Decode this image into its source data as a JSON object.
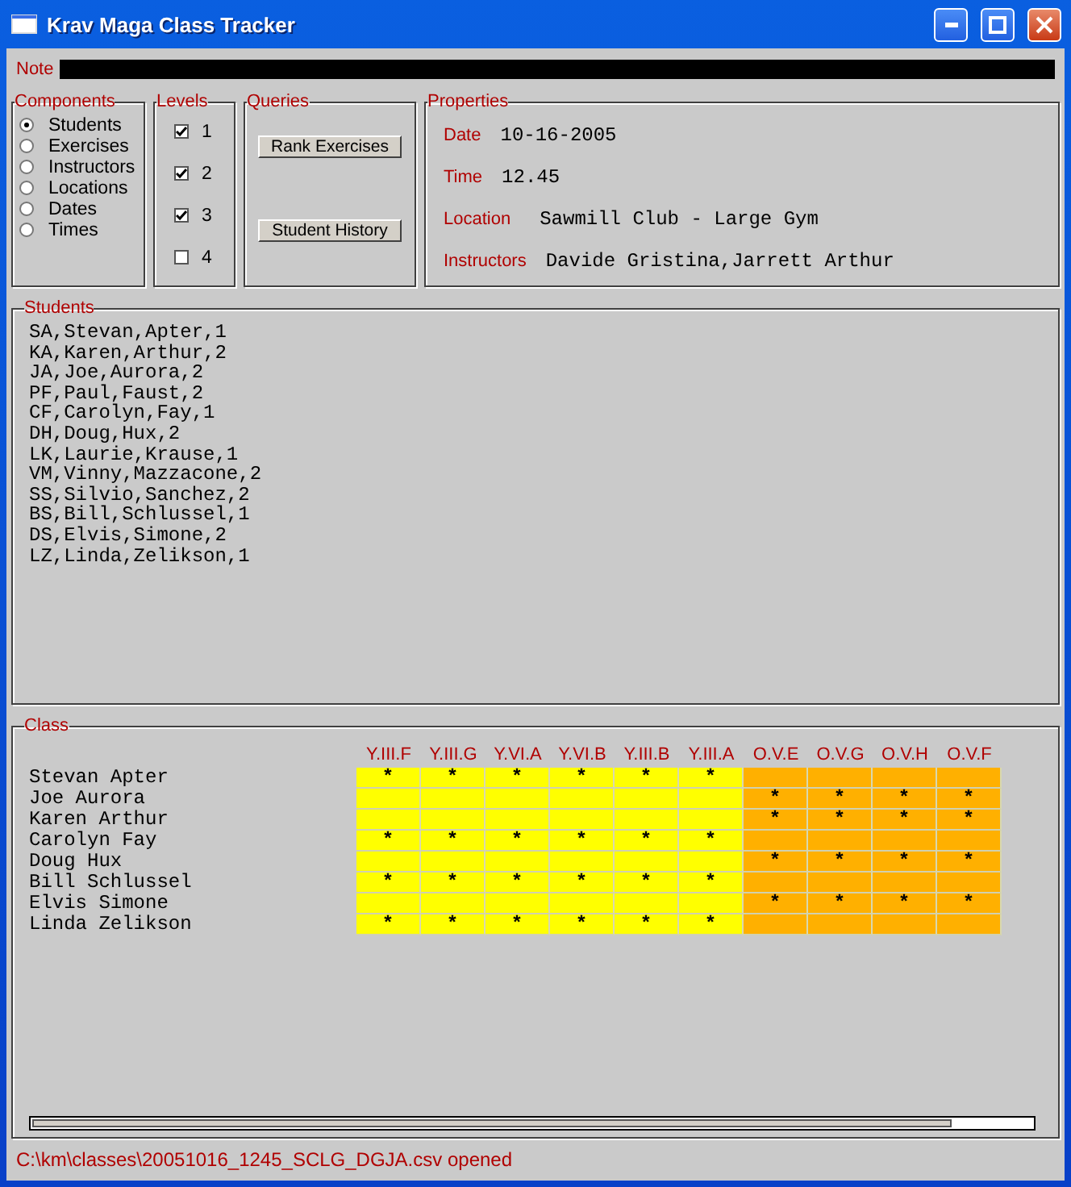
{
  "window": {
    "title": "Krav Maga Class Tracker"
  },
  "note": {
    "label": "Note"
  },
  "components": {
    "title": "Components",
    "options": [
      {
        "label": "Students",
        "selected": true
      },
      {
        "label": "Exercises",
        "selected": false
      },
      {
        "label": "Instructors",
        "selected": false
      },
      {
        "label": "Locations",
        "selected": false
      },
      {
        "label": "Dates",
        "selected": false
      },
      {
        "label": "Times",
        "selected": false
      }
    ]
  },
  "levels": {
    "title": "Levels",
    "items": [
      {
        "label": "1",
        "checked": true
      },
      {
        "label": "2",
        "checked": true
      },
      {
        "label": "3",
        "checked": true
      },
      {
        "label": "4",
        "checked": false
      }
    ]
  },
  "queries": {
    "title": "Queries",
    "buttons": [
      "Rank Exercises",
      "Student History"
    ]
  },
  "properties": {
    "title": "Properties",
    "fields": [
      {
        "label": "Date",
        "value": "10-16-2005"
      },
      {
        "label": "Time",
        "value": "12.45"
      },
      {
        "label": "Location",
        "value": "Sawmill Club - Large Gym"
      },
      {
        "label": "Instructors",
        "value": "Davide Gristina,Jarrett Arthur"
      }
    ]
  },
  "students": {
    "title": "Students",
    "lines": [
      "SA,Stevan,Apter,1",
      "KA,Karen,Arthur,2",
      "JA,Joe,Aurora,2",
      "PF,Paul,Faust,2",
      "CF,Carolyn,Fay,1",
      "DH,Doug,Hux,2",
      "LK,Laurie,Krause,1",
      "VM,Vinny,Mazzacone,2",
      "SS,Silvio,Sanchez,2",
      "BS,Bill,Schlussel,1",
      "DS,Elvis,Simone,2",
      "LZ,Linda,Zelikson,1"
    ]
  },
  "class": {
    "title": "Class",
    "columns": [
      {
        "label": "Y.III.F",
        "color": "#ffff00"
      },
      {
        "label": "Y.III.G",
        "color": "#ffff00"
      },
      {
        "label": "Y.VI.A",
        "color": "#ffff00"
      },
      {
        "label": "Y.VI.B",
        "color": "#ffff00"
      },
      {
        "label": "Y.III.B",
        "color": "#ffff00"
      },
      {
        "label": "Y.III.A",
        "color": "#ffff00"
      },
      {
        "label": "O.V.E",
        "color": "#ffb000"
      },
      {
        "label": "O.V.G",
        "color": "#ffb000"
      },
      {
        "label": "O.V.H",
        "color": "#ffb000"
      },
      {
        "label": "O.V.F",
        "color": "#ffb000"
      }
    ],
    "rows": [
      {
        "name": "Stevan Apter",
        "cells": [
          "*",
          "*",
          "*",
          "*",
          "*",
          "*",
          null,
          null,
          null,
          null
        ]
      },
      {
        "name": "Joe Aurora",
        "cells": [
          null,
          null,
          null,
          null,
          null,
          null,
          "*",
          "*",
          "*",
          "*"
        ]
      },
      {
        "name": "Karen Arthur",
        "cells": [
          null,
          null,
          null,
          null,
          null,
          null,
          "*",
          "*",
          "*",
          "*"
        ]
      },
      {
        "name": "Carolyn Fay",
        "cells": [
          "*",
          "*",
          "*",
          "*",
          "*",
          "*",
          null,
          null,
          null,
          null
        ]
      },
      {
        "name": "Doug Hux",
        "cells": [
          null,
          null,
          null,
          null,
          null,
          null,
          "*",
          "*",
          "*",
          "*"
        ]
      },
      {
        "name": "Bill Schlussel",
        "cells": [
          "*",
          "*",
          "*",
          "*",
          "*",
          "*",
          null,
          null,
          null,
          null
        ]
      },
      {
        "name": "Elvis Simone",
        "cells": [
          null,
          null,
          null,
          null,
          null,
          null,
          "*",
          "*",
          "*",
          "*"
        ]
      },
      {
        "name": "Linda Zelikson",
        "cells": [
          "*",
          "*",
          "*",
          "*",
          "*",
          "*",
          null,
          null,
          null,
          null
        ]
      }
    ]
  },
  "status_bar": {
    "text": "C:\\km\\classes\\20051016_1245_SCLG_DGJA.csv opened"
  }
}
